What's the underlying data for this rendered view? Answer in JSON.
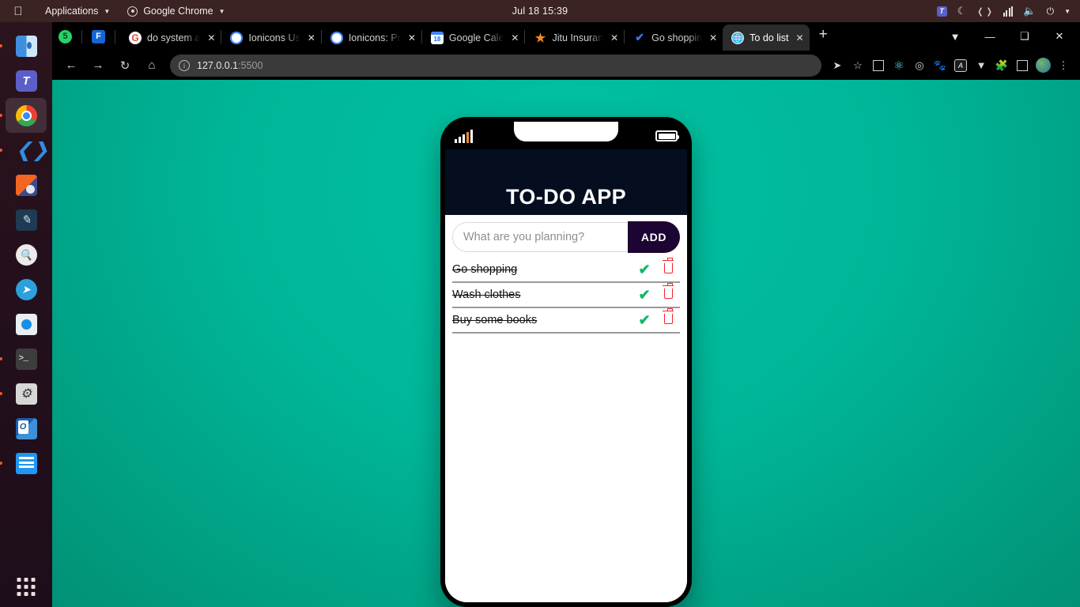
{
  "os_bar": {
    "apple_logo": "apple-logo",
    "applications_label": "Applications",
    "chrome_label": "Google Chrome",
    "clock": "Jul 18  15:39",
    "tray_icons": [
      "teams-icon",
      "night-mode-icon",
      "network-icon",
      "volume-icon",
      "microphone-icon",
      "battery-icon",
      "tray-caret-icon"
    ]
  },
  "dock": {
    "items": [
      {
        "name": "finder-icon",
        "running": true
      },
      {
        "name": "microsoft-teams-icon",
        "running": false
      },
      {
        "name": "google-chrome-icon",
        "running": true,
        "active": true
      },
      {
        "name": "vscode-icon",
        "running": true
      },
      {
        "name": "media-player-icon",
        "running": false
      },
      {
        "name": "design-tool-icon",
        "running": false
      },
      {
        "name": "search-icon",
        "running": false
      },
      {
        "name": "telegram-icon",
        "running": false
      },
      {
        "name": "camera-icon",
        "running": false
      },
      {
        "name": "terminal-icon",
        "running": true
      },
      {
        "name": "settings-icon",
        "running": true
      },
      {
        "name": "outlook-icon",
        "running": false
      },
      {
        "name": "documents-icon",
        "running": true
      }
    ],
    "show_apps_label": "show-applications"
  },
  "browser": {
    "pinned": [
      {
        "label": "5",
        "icon": "whatsapp-icon"
      },
      {
        "label": "F",
        "icon": "feedly-icon"
      }
    ],
    "tabs": [
      {
        "label": "do system a",
        "icon": "google-icon",
        "active": false
      },
      {
        "label": "Ionicons Us",
        "icon": "ionicons-icon",
        "active": false
      },
      {
        "label": "Ionicons: Pr",
        "icon": "ionicons-icon",
        "active": false
      },
      {
        "label": "Google Cale",
        "icon": "google-calendar-icon",
        "active": false
      },
      {
        "label": "Jitu Insuran",
        "icon": "star-icon",
        "active": false
      },
      {
        "label": "Go shoppin",
        "icon": "check-icon",
        "active": false
      },
      {
        "label": "To do list",
        "icon": "globe-icon",
        "active": true
      }
    ],
    "new_tab_label": "+",
    "window_controls": [
      "tab-search-chevron",
      "minimize",
      "maximize",
      "close"
    ],
    "nav": {
      "back": "back-icon",
      "forward": "forward-icon",
      "reload": "reload-icon",
      "home": "home-icon"
    },
    "omnibox": {
      "url_main": "127.0.0.1",
      "url_port": ":5500",
      "info_icon": "site-info-icon"
    },
    "toolbar_right": [
      "share-icon",
      "bookmark-star-icon",
      "screenshot-icon",
      "react-devtools-icon",
      "target-icon",
      "gnome-icon",
      "angular-icon",
      "vue-devtools-icon",
      "extensions-puzzle-icon",
      "sidebar-icon",
      "profile-avatar",
      "chrome-menu-icon"
    ]
  },
  "phone": {
    "status_bar": {
      "signal": "signal-bars-icon",
      "notch": "notch",
      "battery": "battery-icon"
    }
  },
  "app": {
    "title": "TO-DO APP",
    "input": {
      "placeholder": "What are you planning?",
      "value": ""
    },
    "add_button": "ADD",
    "tasks": [
      {
        "text": "Go shopping",
        "completed": true
      },
      {
        "text": "Wash clothes",
        "completed": true
      },
      {
        "text": "Buy some books",
        "completed": true
      }
    ]
  },
  "colors": {
    "background_teal": "#00b698",
    "app_header_navy": "#050e1f",
    "add_button_purple": "#1d0533",
    "check_green": "#12b76a",
    "delete_red": "#f5222d"
  }
}
